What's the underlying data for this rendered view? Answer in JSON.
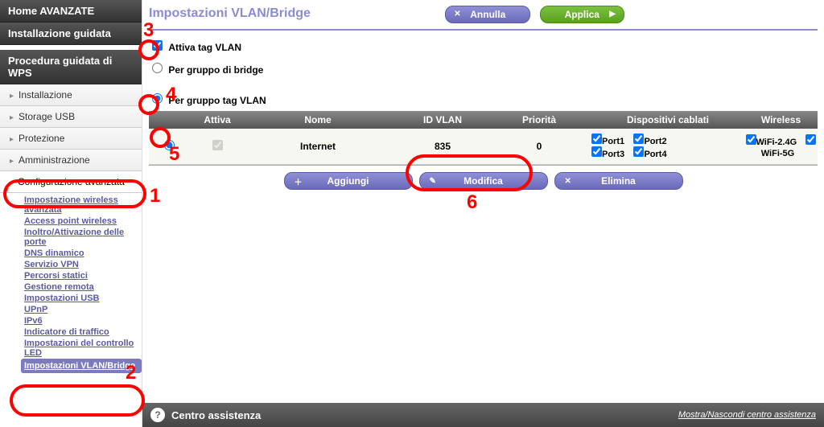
{
  "sidebar": {
    "home": "Home AVANZATE",
    "wizard": "Installazione guidata",
    "wps": "Procedura guidata di WPS",
    "items": [
      "Installazione",
      "Storage USB",
      "Protezione",
      "Amministrazione"
    ],
    "advanced": "Configurazione avanzata",
    "sub": [
      "Impostazione wireless avanzata",
      "Access point wireless",
      "Inoltro/Attivazione delle porte",
      "DNS dinamico",
      "Servizio VPN",
      "Percorsi statici",
      "Gestione remota",
      "Impostazioni USB",
      "UPnP",
      "IPv6",
      "Indicatore di traffico",
      "Impostazioni del controllo LED",
      "Impostazioni VLAN/Bridge"
    ]
  },
  "page": {
    "title": "Impostazioni VLAN/Bridge",
    "cancel": "Annulla",
    "apply": "Applica",
    "enable_vlan": "Attiva tag VLAN",
    "per_bridge": "Per gruppo di bridge",
    "per_vlan": "Per gruppo tag VLAN"
  },
  "table": {
    "headers": {
      "attiva": "Attiva",
      "nome": "Nome",
      "id": "ID VLAN",
      "prio": "Priorità",
      "wired": "Dispositivi cablati",
      "wifi": "Wireless"
    },
    "row": {
      "nome": "Internet",
      "id": "835",
      "prio": "0",
      "port1": "Port1",
      "port2": "Port2",
      "port3": "Port3",
      "port4": "Port4",
      "wifi24": "WiFi-2.4G",
      "wifi5": "WiFi-5G"
    }
  },
  "actions": {
    "add": "Aggiungi",
    "edit": "Modifica",
    "del": "Elimina"
  },
  "help": {
    "title": "Centro assistenza",
    "toggle": "Mostra/Nascondi centro assistenza"
  },
  "anno": {
    "n1": "1",
    "n2": "2",
    "n3": "3",
    "n4": "4",
    "n5": "5",
    "n6": "6"
  }
}
